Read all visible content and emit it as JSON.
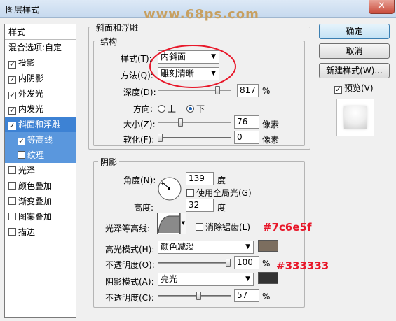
{
  "window": {
    "title": "图层样式",
    "close": "✕"
  },
  "watermark": "www.68ps.com",
  "sidebar": {
    "items": [
      {
        "label": "样式",
        "checkbox": false,
        "checked": false
      },
      {
        "label": "混合选项:自定",
        "checkbox": false,
        "checked": false
      },
      {
        "label": "投影",
        "checkbox": true,
        "checked": true
      },
      {
        "label": "内阴影",
        "checkbox": true,
        "checked": true
      },
      {
        "label": "外发光",
        "checkbox": true,
        "checked": true
      },
      {
        "label": "内发光",
        "checkbox": true,
        "checked": true
      },
      {
        "label": "斜面和浮雕",
        "checkbox": true,
        "checked": true
      },
      {
        "label": "等高线",
        "checkbox": true,
        "checked": true
      },
      {
        "label": "纹理",
        "checkbox": true,
        "checked": false
      },
      {
        "label": "光泽",
        "checkbox": true,
        "checked": false
      },
      {
        "label": "颜色叠加",
        "checkbox": true,
        "checked": false
      },
      {
        "label": "渐变叠加",
        "checkbox": true,
        "checked": false
      },
      {
        "label": "图案叠加",
        "checkbox": true,
        "checked": false
      },
      {
        "label": "描边",
        "checkbox": true,
        "checked": false
      }
    ],
    "selected_index": 6
  },
  "bevel": {
    "group_title": "斜面和浮雕",
    "structure_title": "结构",
    "style_label": "样式(T):",
    "style_value": "内斜面",
    "technique_label": "方法(Q):",
    "technique_value": "雕刻清晰",
    "depth_label": "深度(D):",
    "depth_value": "817",
    "depth_unit": "%",
    "depth_level": 0.85,
    "direction_label": "方向:",
    "dir_up": "上",
    "dir_down": "下",
    "direction_selected": "下",
    "size_label": "大小(Z):",
    "size_value": "76",
    "size_unit": "像素",
    "size_level": 0.3,
    "soften_label": "软化(F):",
    "soften_value": "0",
    "soften_unit": "像素",
    "soften_level": 0.0
  },
  "shading": {
    "title": "阴影",
    "angle_label": "角度(N):",
    "angle_value": "139",
    "angle_unit": "度",
    "global_light_label": "使用全局光(G)",
    "global_light_checked": false,
    "altitude_label": "高度:",
    "altitude_value": "32",
    "altitude_unit": "度",
    "gloss_label": "光泽等高线:",
    "antialias_label": "消除锯齿(L)",
    "antialias_checked": false,
    "highlight_mode_label": "高光模式(H):",
    "highlight_mode_value": "颜色减淡",
    "highlight_color": "#7c6e5f",
    "highlight_opacity_label": "不透明度(O):",
    "highlight_opacity_value": "100",
    "highlight_opacity_unit": "%",
    "highlight_opacity_level": 1.0,
    "shadow_mode_label": "阴影模式(A):",
    "shadow_mode_value": "亮光",
    "shadow_color": "#333333",
    "shadow_opacity_label": "不透明度(C):",
    "shadow_opacity_value": "57",
    "shadow_opacity_unit": "%",
    "shadow_opacity_level": 0.57
  },
  "annotations": {
    "highlight_hex": "#7c6e5f",
    "shadow_hex": "#333333"
  },
  "buttons": {
    "ok": "确定",
    "cancel": "取消",
    "new_style": "新建样式(W)...",
    "preview": "预览(V)",
    "preview_checked": true
  },
  "accent": "#3d82d4"
}
